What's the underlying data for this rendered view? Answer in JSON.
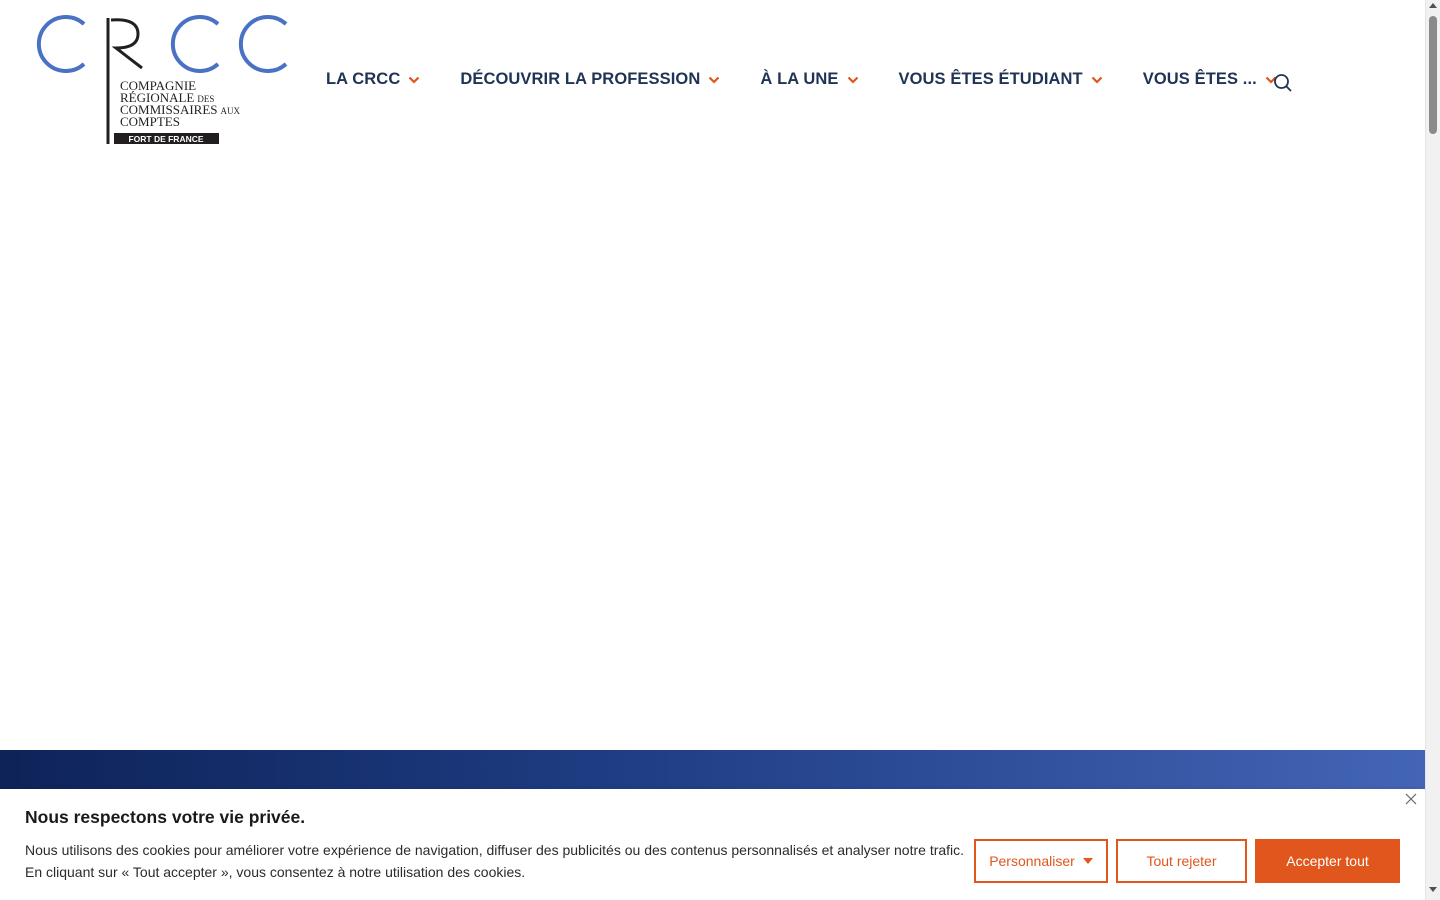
{
  "brand": {
    "logo_letters": "CRCC",
    "logo_line1": "COMPAGNIE",
    "logo_line2": "RÉGIONALE",
    "logo_line2_small": "DES",
    "logo_line3": "COMMISSAIRES",
    "logo_line3_small": "AUX",
    "logo_line4": "COMPTES",
    "logo_badge": "FORT DE FRANCE",
    "blue": "#4a72c4",
    "dark": "#231f20"
  },
  "nav": {
    "items": [
      {
        "label": "LA CRCC"
      },
      {
        "label": "DÉCOUVRIR LA PROFESSION"
      },
      {
        "label": "À LA UNE"
      },
      {
        "label": "VOUS ÊTES ÉTUDIANT"
      },
      {
        "label": "VOUS ÊTES ..."
      }
    ],
    "chevron_icon": "chevron-down-icon",
    "chevron_color": "#e0561c",
    "search_icon": "search-icon"
  },
  "cookie": {
    "title": "Nous respectons votre vie privée.",
    "text": "Nous utilisons des cookies pour améliorer votre expérience de navigation, diffuser des publicités ou des contenus personnalisés et analyser notre trafic. En cliquant sur « Tout accepter », vous consentez à notre utilisation des cookies.",
    "customize_label": "Personnaliser",
    "reject_label": "Tout rejeter",
    "accept_label": "Accepter tout",
    "accent": "#e0561c"
  }
}
